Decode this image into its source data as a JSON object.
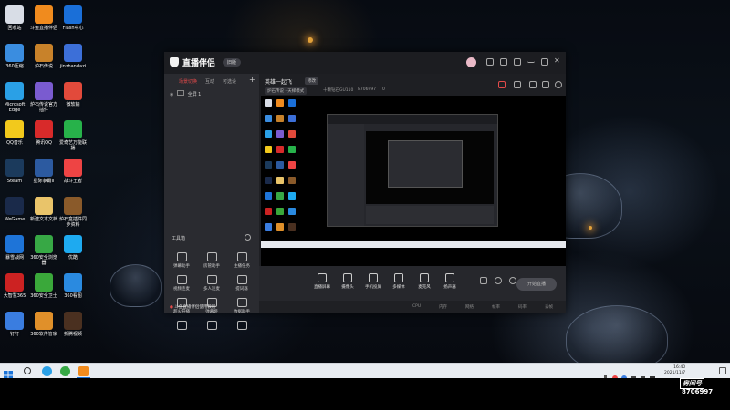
{
  "desktop": {
    "icons": [
      {
        "label": "回收站",
        "color": "#d8dde6",
        "icon": "recycle-bin"
      },
      {
        "label": "斗鱼直播伴侣",
        "color": "#f08b1e",
        "icon": "douyu-companion"
      },
      {
        "label": "Flash中心",
        "color": "#1a6fd8",
        "icon": "flash-center"
      },
      {
        "label": "360压缩",
        "color": "#3a8de0",
        "icon": "360zip"
      },
      {
        "label": "炉石传说",
        "color": "#c8822a",
        "icon": "hearthstone"
      },
      {
        "label": "jinzhandazi",
        "color": "#3c6fd8",
        "icon": "typing-app"
      },
      {
        "label": "Microsoft\nEdge",
        "color": "#2aa0e6",
        "icon": "edge"
      },
      {
        "label": "炉石传说官方\n插件",
        "color": "#7a5bd0",
        "icon": "hs-plugin"
      },
      {
        "label": "微软输",
        "color": "#e24a3b",
        "icon": "ime"
      },
      {
        "label": "QQ音乐",
        "color": "#f2c91c",
        "icon": "qq-music"
      },
      {
        "label": "腾讯QQ",
        "color": "#d82a2a",
        "icon": "tencent-qq"
      },
      {
        "label": "爱奇艺万能联\n播",
        "color": "#27b24a",
        "icon": "iqiyi"
      },
      {
        "label": "Steam",
        "color": "#1b3a5c",
        "icon": "steam"
      },
      {
        "label": "星际争霸II",
        "color": "#2c5aa0",
        "icon": "starcraft"
      },
      {
        "label": "战斗王者",
        "color": "#e44",
        "icon": "battle-app"
      },
      {
        "label": "WeGame",
        "color": "#1a2a4a",
        "icon": "wegame"
      },
      {
        "label": "新建文本文档",
        "color": "#e9c46a",
        "icon": "text-doc"
      },
      {
        "label": "炉石盒插件同\n步资料",
        "color": "#8a5a2a",
        "icon": "hs-box"
      },
      {
        "label": "暴雪战网",
        "color": "#1e74d8",
        "icon": "battlenet"
      },
      {
        "label": "360安全浏览\n器",
        "color": "#37a845",
        "icon": "360browser"
      },
      {
        "label": "优酷",
        "color": "#1eaaf0",
        "icon": "youku"
      },
      {
        "label": "大智慧365",
        "color": "#c22",
        "icon": "dzh"
      },
      {
        "label": "360安全卫士",
        "color": "#3aa83a",
        "icon": "360guard"
      },
      {
        "label": "360看图",
        "color": "#2a8ae0",
        "icon": "360image"
      },
      {
        "label": "钉钉",
        "color": "#3a7de0",
        "icon": "dingtalk"
      },
      {
        "label": "360软件管家",
        "color": "#e0902a",
        "icon": "360soft"
      },
      {
        "label": "折腾视频",
        "color": "#4a3020",
        "icon": "video"
      }
    ]
  },
  "app": {
    "name": "直播伴侣",
    "version_badge": "旧版",
    "sidebar": {
      "tabs": [
        "场景切换",
        "互动",
        "可选设"
      ],
      "scene_item": "全屏 1",
      "tools_title": "工具箱",
      "tools": [
        "弹幕助手",
        "房管助手",
        "主播任务",
        "视频连麦",
        "多人连麦",
        "提词器",
        "超火开播",
        "弹幕姬",
        "数据助手",
        "",
        "",
        ""
      ]
    },
    "header": {
      "room_title": "英雄一起飞",
      "room_title_tag": "修改",
      "category": "炉石传说 · 天梯模式",
      "room_id": "十颗钻石GU110",
      "room_number": "8706997",
      "viewers": "0"
    },
    "bottom_tools": [
      "直播屏幕",
      "摄像头",
      "手机投屏",
      "多媒体",
      "麦克风",
      "扬声器"
    ],
    "start_button": "开始直播",
    "statusbar": {
      "notice": "斗鱼直播伴侣使用教程",
      "items": [
        "CPU",
        "内存",
        "网络",
        "帧率",
        "码率",
        "丢帧"
      ]
    }
  },
  "taskbar": {
    "time": "16:40",
    "date": "2021/11/7"
  },
  "overlay": {
    "room_label": "房间号",
    "room_number": "8706997"
  }
}
